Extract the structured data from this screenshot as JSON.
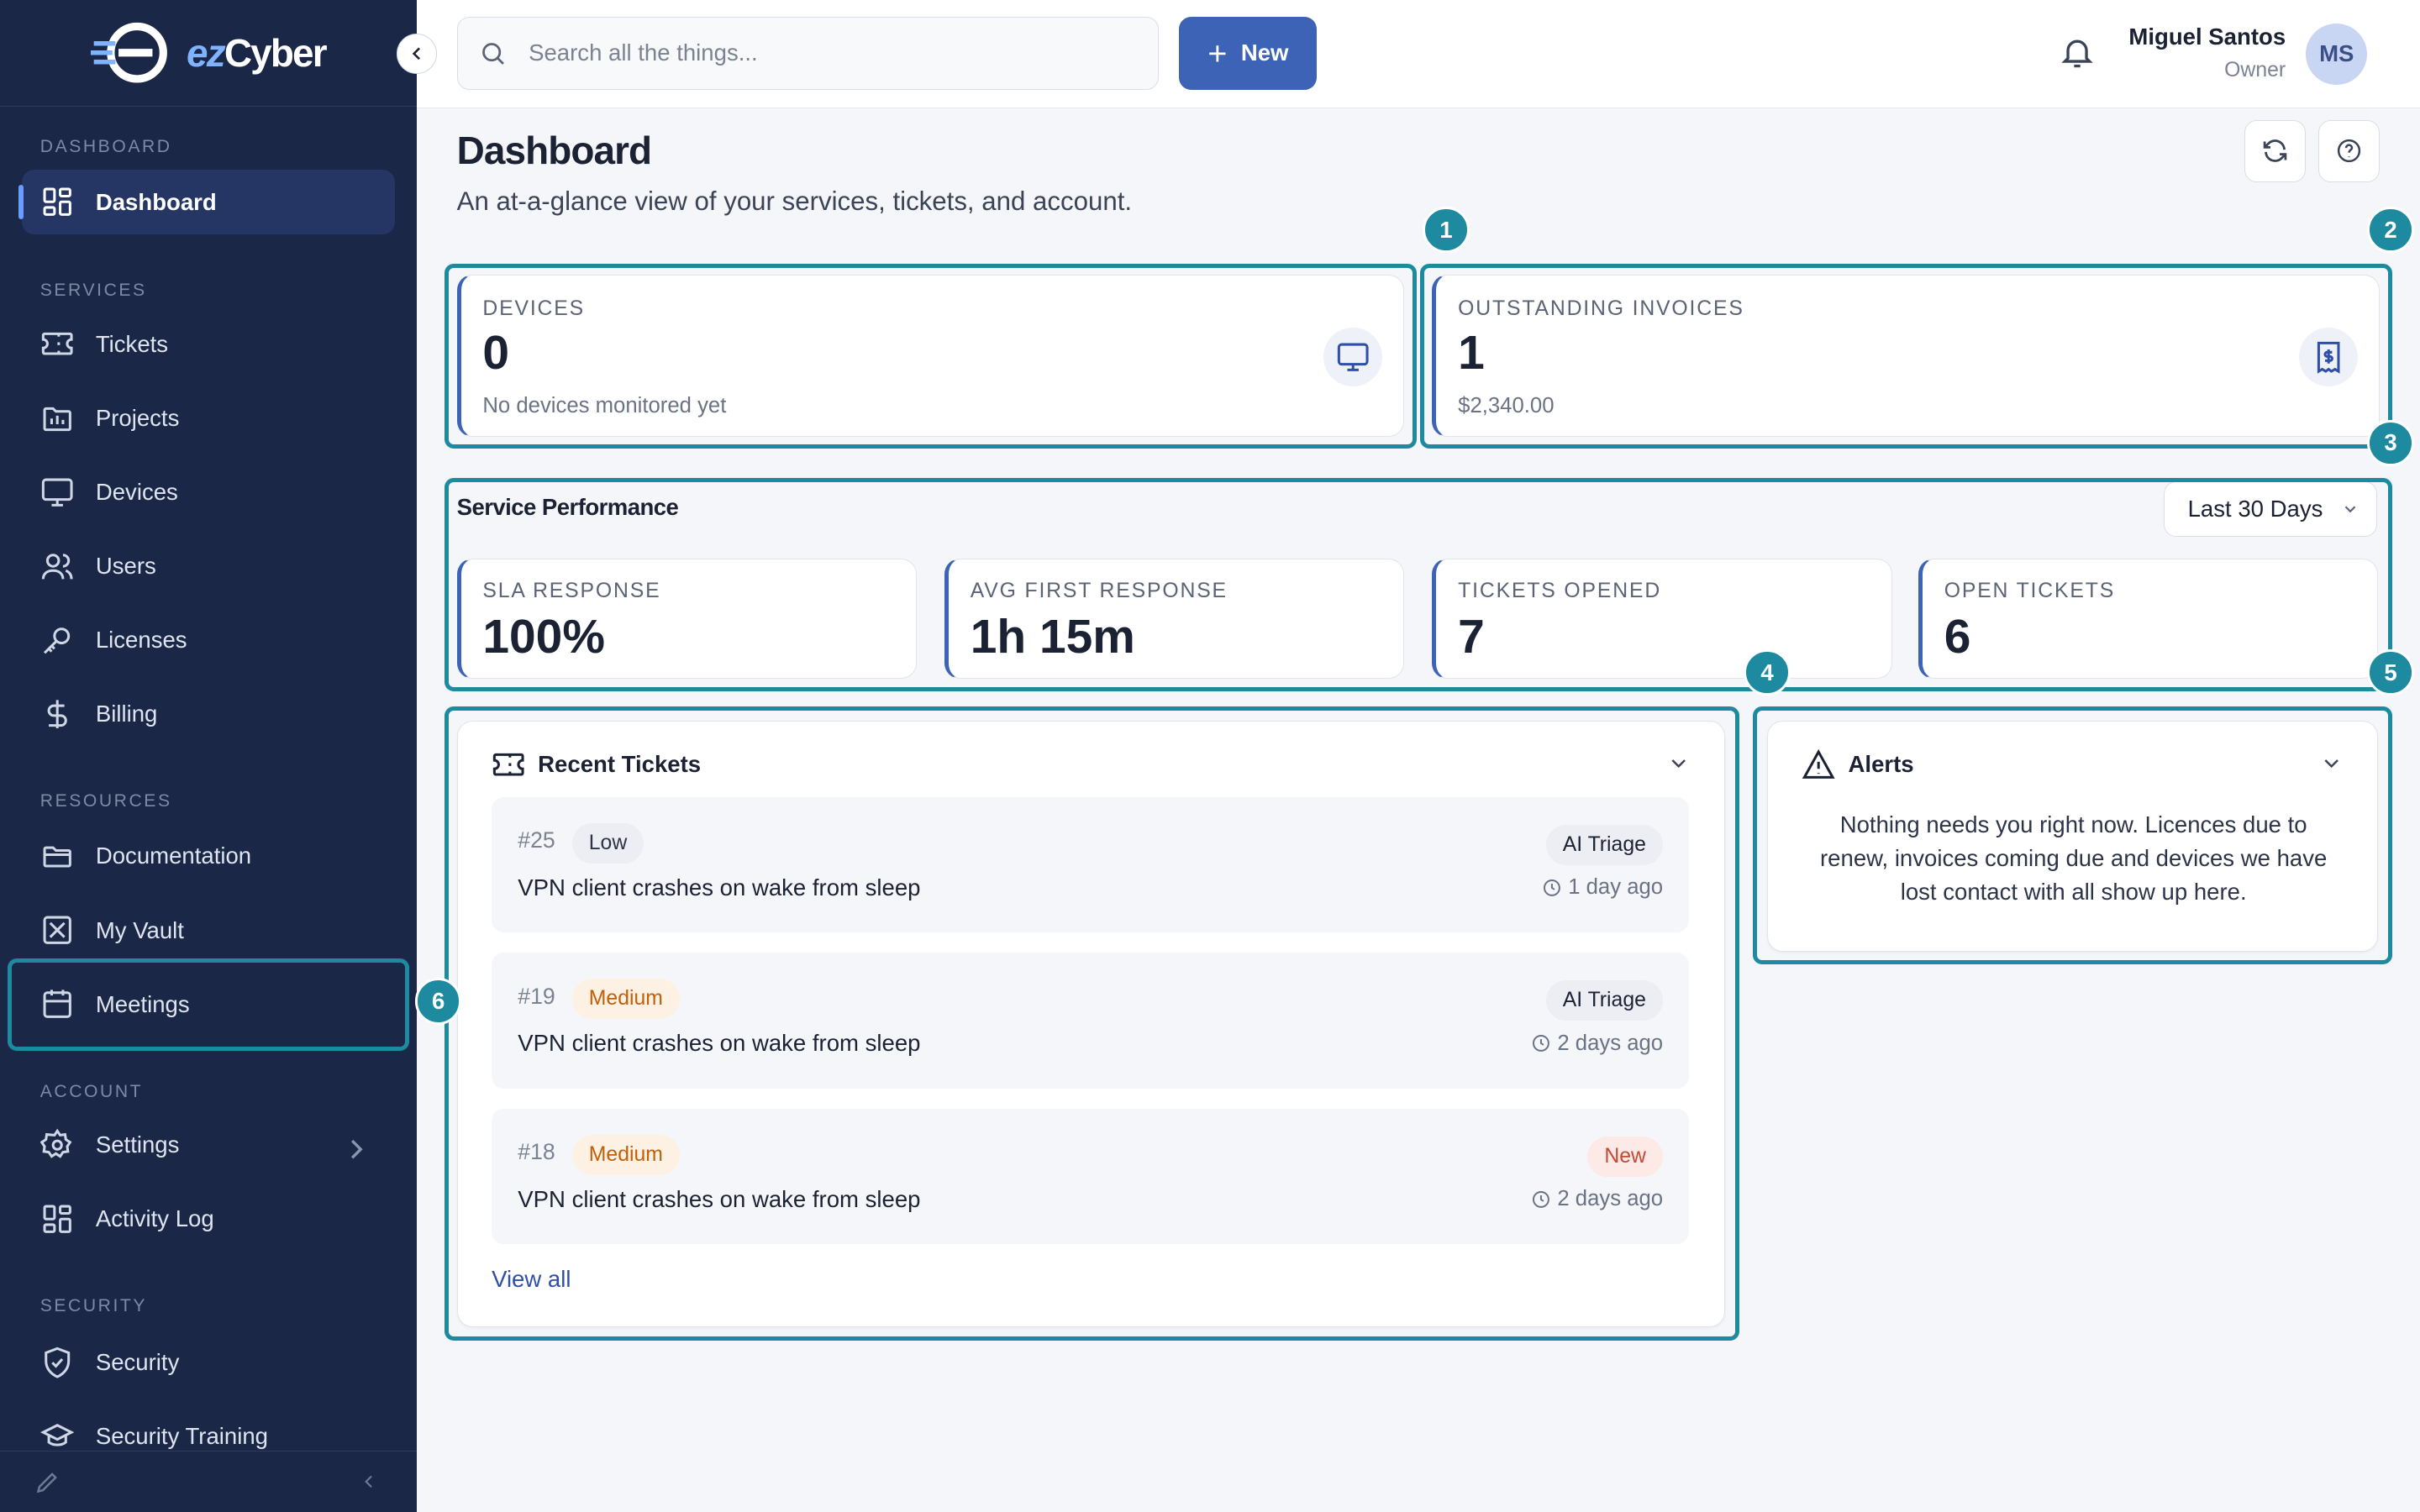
{
  "app": {
    "brand_prefix": "ez",
    "brand_suffix": "Cyber"
  },
  "sidebar": {
    "sections": [
      {
        "label": "DASHBOARD",
        "items": [
          {
            "label": "Dashboard",
            "icon": "grid-icon",
            "active": true
          }
        ]
      },
      {
        "label": "SERVICES",
        "items": [
          {
            "label": "Tickets",
            "icon": "ticket-icon"
          },
          {
            "label": "Projects",
            "icon": "projects-icon"
          },
          {
            "label": "Devices",
            "icon": "monitor-icon"
          },
          {
            "label": "Users",
            "icon": "users-icon"
          },
          {
            "label": "Licenses",
            "icon": "key-icon"
          },
          {
            "label": "Billing",
            "icon": "dollar-icon"
          }
        ]
      },
      {
        "label": "RESOURCES",
        "items": [
          {
            "label": "Documentation",
            "icon": "folder-icon"
          },
          {
            "label": "My Vault",
            "icon": "vault-icon"
          },
          {
            "label": "Meetings",
            "icon": "calendar-icon"
          }
        ]
      },
      {
        "label": "ACCOUNT",
        "items": [
          {
            "label": "Settings",
            "icon": "gear-icon"
          },
          {
            "label": "Activity Log",
            "icon": "grid-icon"
          }
        ]
      },
      {
        "label": "SECURITY",
        "items": [
          {
            "label": "Security",
            "icon": "shield-icon"
          },
          {
            "label": "Security Training",
            "icon": "graduation-cap-icon"
          }
        ]
      }
    ]
  },
  "topbar": {
    "search_placeholder": "Search all the things...",
    "new_label": "New",
    "user_name": "Miguel Santos",
    "user_role": "Owner",
    "avatar_initials": "MS"
  },
  "page": {
    "title": "Dashboard",
    "subtitle": "An at-a-glance view of your services, tickets, and account."
  },
  "stats": {
    "devices": {
      "label": "DEVICES",
      "value": "0",
      "note": "No devices monitored yet"
    },
    "invoices": {
      "label": "OUTSTANDING INVOICES",
      "value": "1",
      "note": "$2,340.00"
    }
  },
  "performance": {
    "title": "Service Performance",
    "range": "Last 30 Days",
    "metrics": [
      {
        "label": "SLA RESPONSE",
        "value": "100%"
      },
      {
        "label": "AVG FIRST RESPONSE",
        "value": "1h 15m"
      },
      {
        "label": "TICKETS OPENED",
        "value": "7"
      },
      {
        "label": "OPEN TICKETS",
        "value": "6"
      }
    ]
  },
  "recent_tickets": {
    "title": "Recent Tickets",
    "view_all": "View all",
    "items": [
      {
        "id": "#25",
        "priority": "Low",
        "title": "VPN client crashes on wake from sleep",
        "tag": "AI Triage",
        "time": "1 day ago"
      },
      {
        "id": "#19",
        "priority": "Medium",
        "title": "VPN client crashes on wake from sleep",
        "tag": "AI Triage",
        "time": "2 days ago"
      },
      {
        "id": "#18",
        "priority": "Medium",
        "title": "VPN client crashes on wake from sleep",
        "tag": "New",
        "time": "2 days ago"
      }
    ]
  },
  "alerts": {
    "title": "Alerts",
    "message": "Nothing needs you right now. Licences due to renew, invoices coming due and devices we have lost contact with all show up here."
  },
  "callouts": [
    "1",
    "2",
    "3",
    "4",
    "5",
    "6"
  ],
  "colors": {
    "sidebar_bg": "#1a2746",
    "accent": "#3d63b7",
    "highlight": "#1d8aa0",
    "priority_low_bg": "#eef0f4",
    "priority_medium_bg": "#fdf1e3",
    "priority_medium_text": "#c2600a",
    "tag_new_bg": "#fde9e6",
    "tag_new_text": "#c44a34"
  }
}
